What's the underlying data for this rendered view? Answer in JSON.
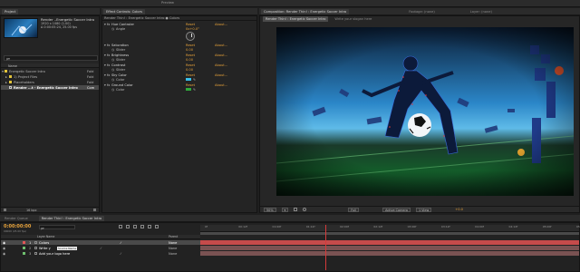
{
  "top_bar": {
    "left_text": "",
    "mid_text": "Preview",
    "right_text": ""
  },
  "project": {
    "tabs": [
      "Project",
      "×"
    ],
    "comp_name": "Render ..Energetic Soccer Intro",
    "comp_info_1": "1920 x 1080 (1.00)",
    "comp_info_2": "Δ 0:00:05:24, 25.00 fps",
    "search_placeholder": "ρ▾",
    "col_name": "Name",
    "tree": [
      {
        "label": "Energetic Soccer Intro",
        "indent": 0,
        "selected": false
      },
      {
        "label": "1) Project Files",
        "indent": 1,
        "selected": false
      },
      {
        "label": "Placeholders",
        "indent": 1,
        "selected": false
      },
      {
        "label": "Render ...t - Energetic Soccer Intro",
        "indent": 2,
        "selected": true
      }
    ],
    "tree_right": [
      "Fold",
      "Fold",
      "Fold",
      "Com"
    ],
    "footer": "16 bpc"
  },
  "effects": {
    "tab": "Effect Controls: Colors",
    "header": "Render Thin! : Energetic Soccer Intro ● Colors",
    "params": [
      {
        "label": "Hue Controler",
        "reset": "Reset",
        "about": "About..."
      },
      {
        "label": "Angle",
        "value": "0x+0.0°"
      },
      {
        "label": "Saturation",
        "reset": "Reset",
        "about": "About..."
      },
      {
        "label": "Slider",
        "value": "0.00"
      },
      {
        "label": "Brightness",
        "reset": "Reset",
        "about": "About..."
      },
      {
        "label": "Slider",
        "value": "0.00"
      },
      {
        "label": "Contrast",
        "reset": "Reset",
        "about": "About..."
      },
      {
        "label": "Slider",
        "value": "0.00"
      },
      {
        "label": "Sky Color",
        "reset": "Reset",
        "about": "About..."
      },
      {
        "label": "Color",
        "value": ""
      },
      {
        "label": "Ground Color",
        "reset": "Reset",
        "about": "About..."
      },
      {
        "label": "Color",
        "value": ""
      }
    ],
    "sky_color": "#39c0e8",
    "ground_color": "#2faa3c"
  },
  "composition": {
    "tabs": [
      "Composition: Render Thin! : Energetic Soccer Intro",
      "Footage: (none)",
      "Layer: (none)"
    ],
    "subtabs": [
      "Render Thin! : Energetic Soccer Intro",
      "Write your slogan here"
    ],
    "footer": [
      "50%",
      "▾",
      "Full",
      "Active Camera",
      "1 View",
      "+0.0"
    ]
  },
  "timeline": {
    "tabs": [
      "Render Queue",
      "Render Thin! : Energetic Soccer Intro"
    ],
    "timecode": "0:00:00:00",
    "timecode_sub": "00000 (25.00 fps)",
    "search_placeholder": "ρ▾",
    "ticks": [
      "0f",
      "00:12f",
      "01:00f",
      "01:12f",
      "02:00f",
      "02:12f",
      "03:00f",
      "03:12f",
      "04:00f",
      "04:12f",
      "05:00f",
      "05:12f"
    ],
    "col_layer": "Layer Name",
    "col_parent": "Parent",
    "layers": [
      {
        "num": "1",
        "name": "Colors",
        "parent": "None",
        "color": "#e05757",
        "selected": true
      },
      {
        "num": "2",
        "name": "Write y",
        "parent": "None",
        "color": "#6fbf6f",
        "selected": false
      },
      {
        "num": "3",
        "name": "Add your logo here",
        "parent": "None",
        "color": "#6fbf6f",
        "selected": false
      }
    ],
    "tooltip": "Source Name"
  },
  "colors": {
    "accent": "#e7a23a",
    "link": "#7aa9e8",
    "bar": "#d63a3a"
  }
}
